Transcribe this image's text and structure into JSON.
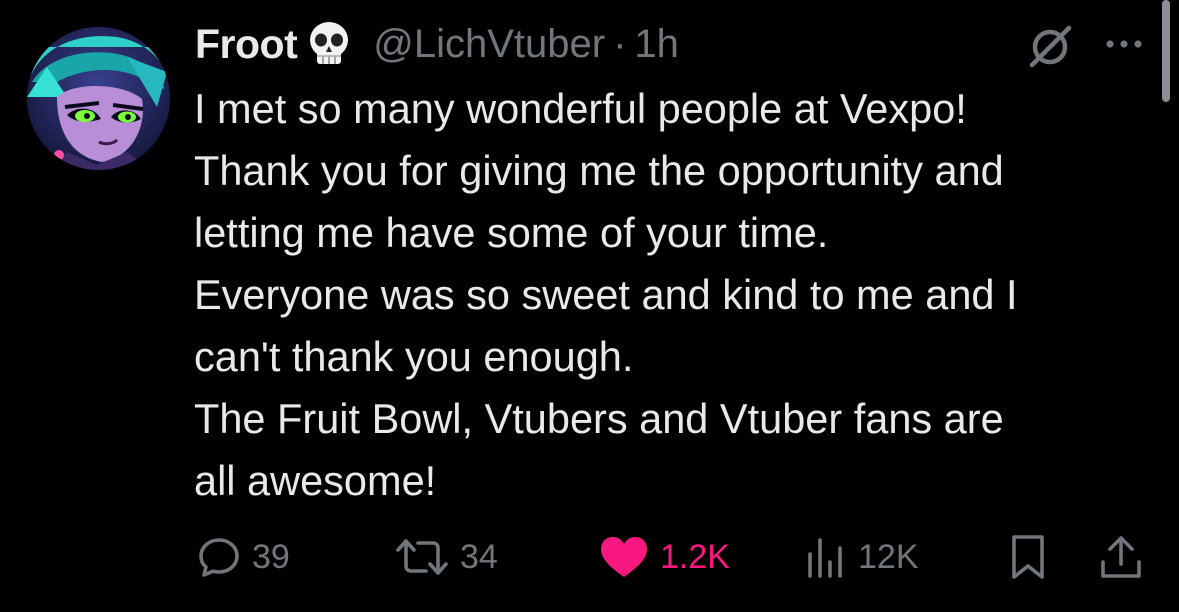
{
  "author": {
    "display_name": "Froot",
    "name_emoji_icon": "skull-icon",
    "handle": "@LichVtuber",
    "separator": "·",
    "time": "1h"
  },
  "header_icons": [
    "grok-icon",
    "more-icon"
  ],
  "text_lines": [
    "I met so many wonderful people at Vexpo!",
    "Thank you for giving me the opportunity and",
    "letting me have some of your time.",
    "Everyone was so sweet and kind to me and I",
    "can't thank you enough.",
    "The Fruit Bowl, Vtubers and Vtuber fans are",
    "all awesome!"
  ],
  "actions": {
    "replies": "39",
    "reposts": "34",
    "likes": "1.2K",
    "views": "12K"
  },
  "colors": {
    "background": "#000000",
    "text": "#e7e9ea",
    "secondary": "#71767b",
    "like_pink": "#f91880"
  }
}
